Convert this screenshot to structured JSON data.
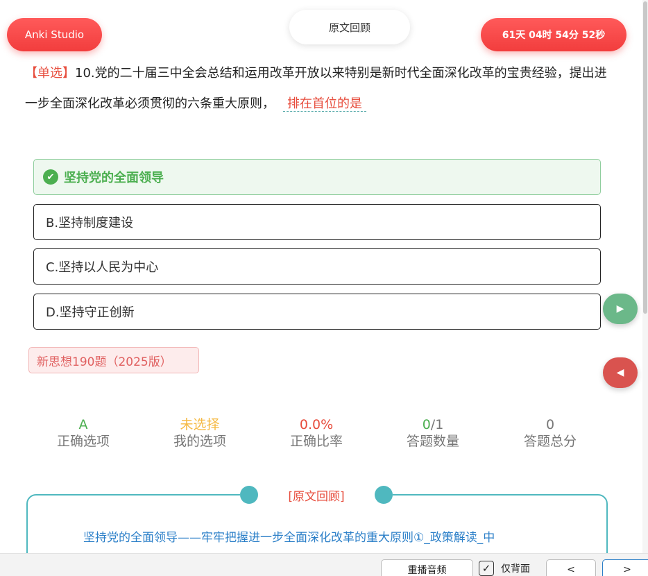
{
  "header": {
    "brand": "Anki Studio",
    "review_button": "原文回顾",
    "timer": "61天 04时 54分 52秒"
  },
  "question": {
    "type_tag": "【单选】",
    "text": "10.党的二十届三中全会总结和运用改革开放以来特别是新时代全面深化改革的宝贵经验，提出进一步全面深化改革必须贯彻的六条重大原则，",
    "blank": "排在首位的是"
  },
  "options": [
    {
      "label": "坚持党的全面领导",
      "correct": true
    },
    {
      "label": "B.坚持制度建设",
      "correct": false
    },
    {
      "label": "C.坚持以人民为中心",
      "correct": false
    },
    {
      "label": "D.坚持守正创新",
      "correct": false
    }
  ],
  "source_tag": "新思想190题（2025版）",
  "stats": {
    "correct_option": {
      "value": "A",
      "label": "正确选项",
      "color": "#4caf50"
    },
    "my_option": {
      "value": "未选择",
      "label": "我的选项",
      "color": "#f5b942"
    },
    "accuracy": {
      "value": "0.0%",
      "label": "正确比率",
      "color": "#e74c3c"
    },
    "answered": {
      "value_done": "0",
      "value_total": "/1",
      "label": "答题数量",
      "color": "#4caf50"
    },
    "total": {
      "value": "0",
      "label": "答题总分",
      "color": "#777777"
    }
  },
  "review": {
    "title": "[原文回顾]",
    "link": "坚持党的全面领导——牢牢把握进一步全面深化改革的重大原则①_政策解读_中"
  },
  "bottom_bar": {
    "replay": "重播音频",
    "back_only": "仅背面",
    "prev": "<",
    "next": ">"
  },
  "colors": {
    "accent_red": "#f23d3d",
    "teal": "#4fb8bf",
    "green": "#4caf50"
  }
}
